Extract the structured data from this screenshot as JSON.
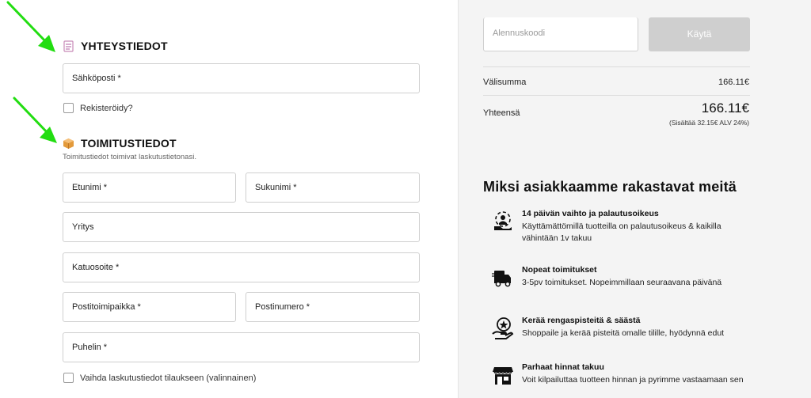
{
  "contact": {
    "heading": "YHTEYSTIEDOT",
    "email_placeholder": "Sähköposti *",
    "register_label": "Rekisteröidy?"
  },
  "shipping": {
    "heading": "TOIMITUSTIEDOT",
    "subtext": "Toimitustiedot toimivat laskutustietonasi.",
    "first_name_placeholder": "Etunimi *",
    "last_name_placeholder": "Sukunimi *",
    "company_placeholder": "Yritys",
    "street_placeholder": "Katuosoite *",
    "city_placeholder": "Postitoimipaikka *",
    "postcode_placeholder": "Postinumero *",
    "phone_placeholder": "Puhelin *",
    "change_billing_label": "Vaihda laskutustiedot tilaukseen (valinnainen)"
  },
  "summary": {
    "coupon_placeholder": "Alennuskoodi",
    "coupon_button": "Käytä",
    "subtotal_label": "Välisumma",
    "subtotal_value": "166.11€",
    "total_label": "Yhteensä",
    "total_value": "166.11€",
    "tax_note": "(Sisältää 32.15€ ALV 24%)"
  },
  "why": {
    "title": "Miksi asiakkaamme rakastavat meitä",
    "features": [
      {
        "icon": "return-exchange-icon",
        "title": "14 päivän vaihto ja palautusoikeus",
        "desc": "Käyttämättömillä tuotteilla on palautusoikeus & kaikilla vähintään 1v takuu"
      },
      {
        "icon": "delivery-truck-icon",
        "title": "Nopeat toimitukset",
        "desc": "3-5pv toimitukset. Nopeimmillaan seuraavana päivänä"
      },
      {
        "icon": "reward-star-hand-icon",
        "title": "Kerää rengaspisteitä & säästä",
        "desc": "Shoppaile ja kerää pisteitä omalle tilille, hyödynnä edut"
      },
      {
        "icon": "store-icon",
        "title": "Parhaat hinnat takuu",
        "desc": "Voit kilpailuttaa tuotteen hinnan ja pyrimme vastaamaan sen"
      }
    ]
  },
  "colors": {
    "arrow": "#22dd11",
    "panel_bg": "#f4f4f4",
    "button_disabled": "#cfcfcf"
  }
}
